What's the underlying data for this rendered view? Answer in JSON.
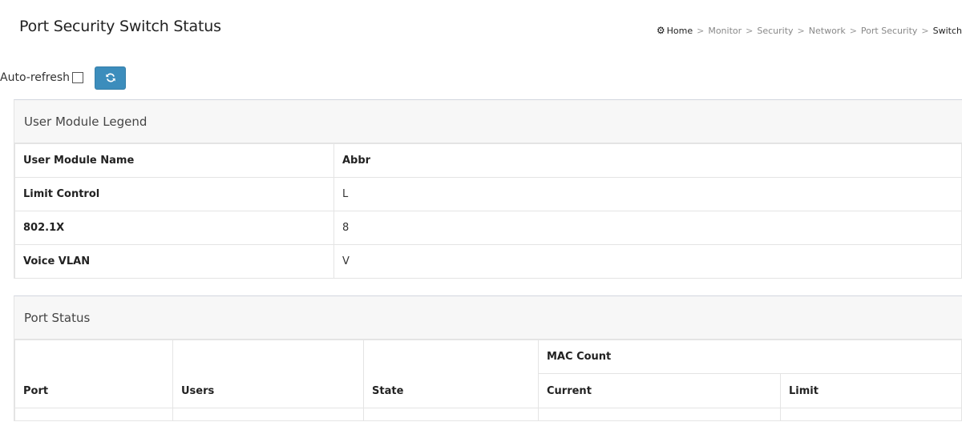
{
  "header": {
    "title": "Port Security Switch Status",
    "breadcrumb": [
      "Home",
      "Monitor",
      "Security",
      "Network",
      "Port Security",
      "Switch"
    ],
    "breadcrumb_sep": ">"
  },
  "toolbar": {
    "auto_refresh_label": "Auto-refresh",
    "auto_refresh_checked": false,
    "refresh_icon": "refresh-icon"
  },
  "legend": {
    "title": "User Module Legend",
    "columns": [
      "User Module Name",
      "Abbr"
    ],
    "rows": [
      {
        "name": "Limit Control",
        "abbr": "L"
      },
      {
        "name": "802.1X",
        "abbr": "8"
      },
      {
        "name": "Voice VLAN",
        "abbr": "V"
      }
    ]
  },
  "port_status": {
    "title": "Port Status",
    "columns": {
      "port": "Port",
      "users": "Users",
      "state": "State",
      "mac_count": "MAC Count",
      "current": "Current",
      "limit": "Limit"
    }
  },
  "colors": {
    "button_bg": "#3c8dbc",
    "panel_header_bg": "#f7f7f7",
    "border": "#e4e4e4"
  }
}
